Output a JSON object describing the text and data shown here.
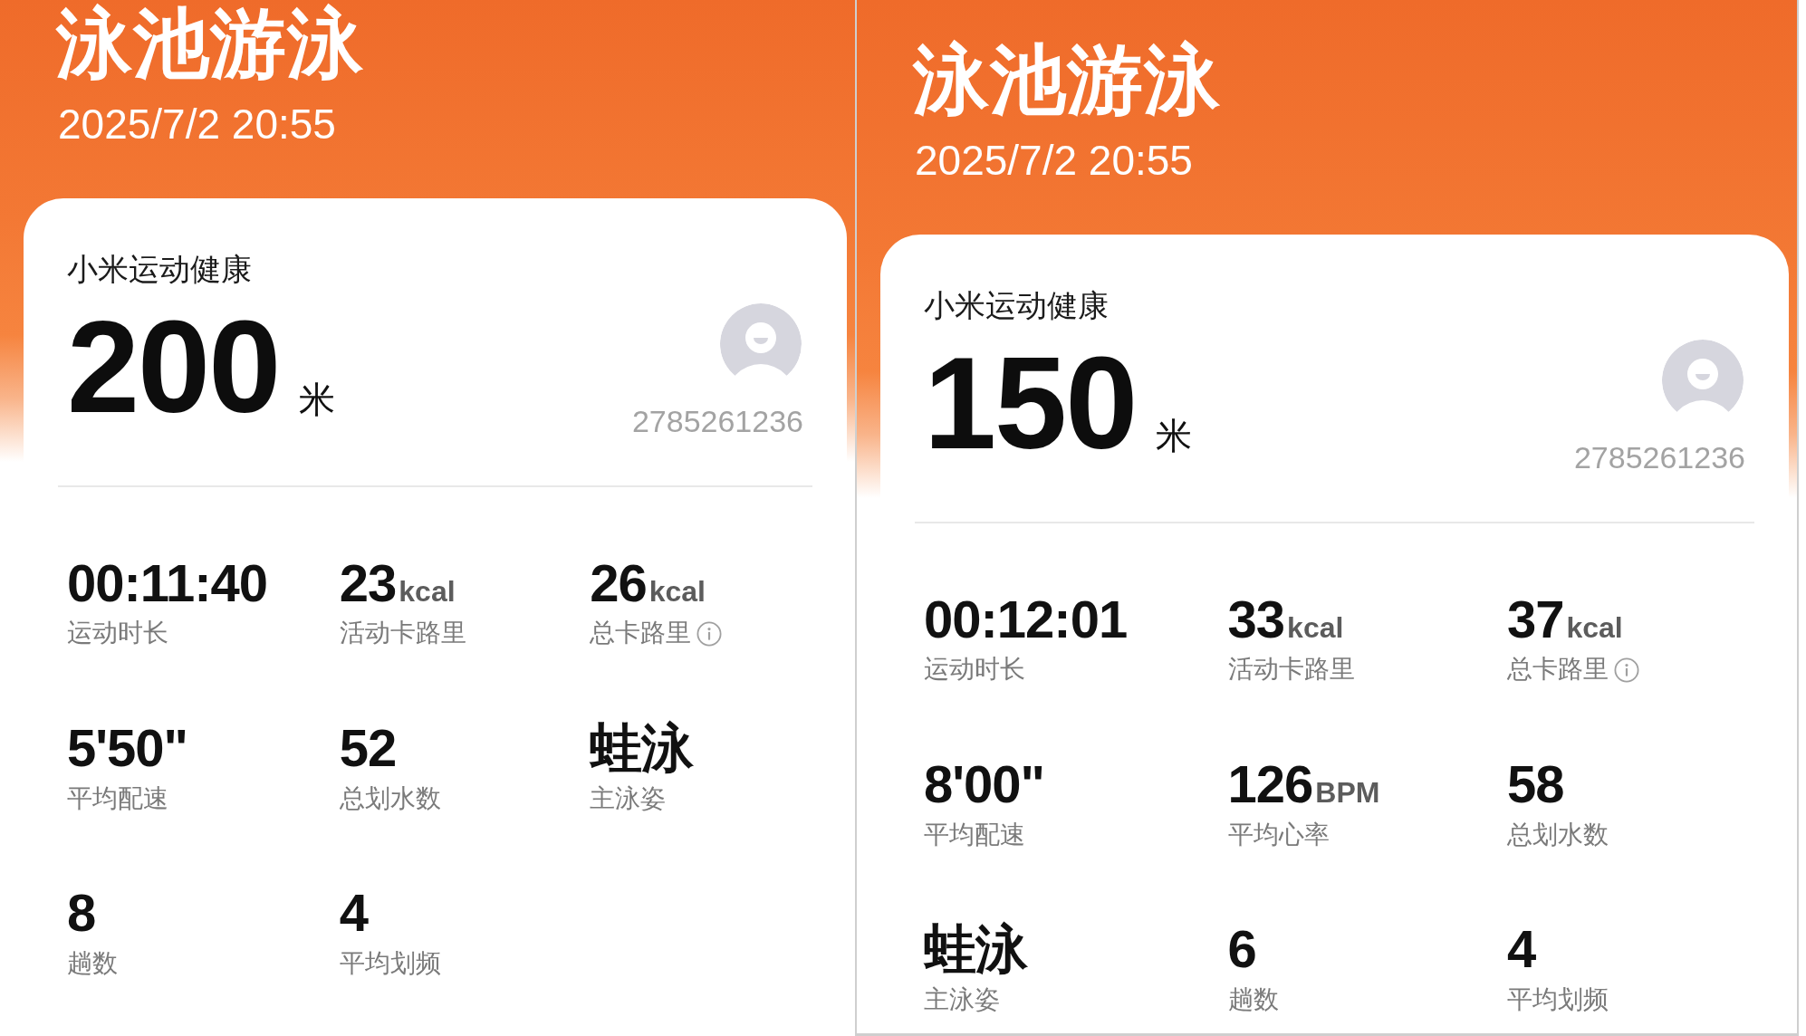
{
  "panels": [
    {
      "title": "泳池游泳",
      "datetime": "2025/7/2 20:55",
      "card": {
        "app_name": "小米运动健康",
        "distance": {
          "value": "200",
          "unit": "米"
        },
        "user_id": "2785261236",
        "stats": [
          {
            "value": "00:11:40",
            "label": "运动时长",
            "info_icon": false
          },
          {
            "value": "23",
            "unit": "kcal",
            "label": "活动卡路里",
            "info_icon": false
          },
          {
            "value": "26",
            "unit": "kcal",
            "label": "总卡路里",
            "info_icon": true
          },
          {
            "value": "5'50\"",
            "label": "平均配速",
            "info_icon": false
          },
          {
            "value": "52",
            "label": "总划水数",
            "info_icon": false
          },
          {
            "value": "蛙泳",
            "label": "主泳姿",
            "info_icon": false
          },
          {
            "value": "8",
            "label": "趟数",
            "info_icon": false
          },
          {
            "value": "4",
            "label": "平均划频",
            "info_icon": false
          }
        ]
      }
    },
    {
      "title": "泳池游泳",
      "datetime": "2025/7/2 20:55",
      "card": {
        "app_name": "小米运动健康",
        "distance": {
          "value": "150",
          "unit": "米"
        },
        "user_id": "2785261236",
        "stats": [
          {
            "value": "00:12:01",
            "label": "运动时长",
            "info_icon": false
          },
          {
            "value": "33",
            "unit": "kcal",
            "label": "活动卡路里",
            "info_icon": false
          },
          {
            "value": "37",
            "unit": "kcal",
            "label": "总卡路里",
            "info_icon": true
          },
          {
            "value": "8'00\"",
            "label": "平均配速",
            "info_icon": false
          },
          {
            "value": "126",
            "unit": "BPM",
            "label": "平均心率",
            "info_icon": false
          },
          {
            "value": "58",
            "label": "总划水数",
            "info_icon": false
          },
          {
            "value": "蛙泳",
            "label": "主泳姿",
            "info_icon": false
          },
          {
            "value": "6",
            "label": "趟数",
            "info_icon": false
          },
          {
            "value": "4",
            "label": "平均划频",
            "info_icon": false
          }
        ]
      }
    }
  ]
}
